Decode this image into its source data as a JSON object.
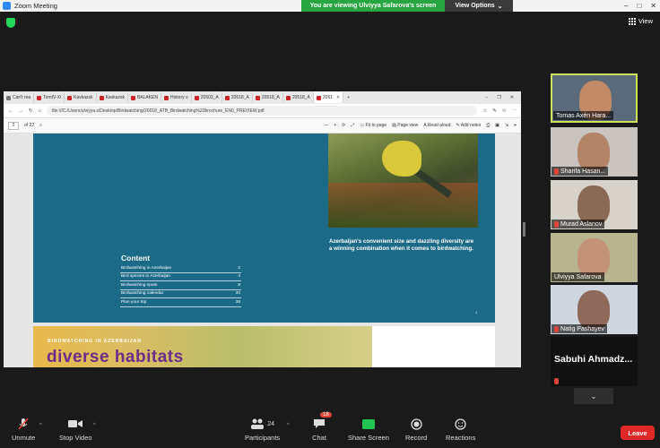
{
  "window": {
    "title": "Zoom Meeting",
    "controls": [
      "–",
      "□",
      "✕"
    ]
  },
  "banner": {
    "viewing": "You are viewing Ulviyya Safarova's screen",
    "view_options": "View Options",
    "chevron": "⌄"
  },
  "top_right": {
    "view_label": "View"
  },
  "browser": {
    "tabs": [
      {
        "label": "Can't rea"
      },
      {
        "label": "TomIV-Xi"
      },
      {
        "label": "Kavkazsk"
      },
      {
        "label": "Kavkazsk"
      },
      {
        "label": "BALAKEN"
      },
      {
        "label": "History o"
      },
      {
        "label": "20503_A"
      },
      {
        "label": "20518_A"
      },
      {
        "label": "20518_A"
      },
      {
        "label": "20518_A"
      },
      {
        "label": "2051"
      }
    ],
    "new_tab": "+",
    "url": "file:///C:/Users/ulviyya.s/Desktop/Birdwatching/20018_ATB_Birdwatching%20brochure_EN0_PREVIEW.pdf",
    "page_current": "2",
    "page_total": "of 22",
    "toolbar": {
      "zoom_out": "—",
      "zoom_in": "+",
      "fit_to_page": "Fit to page",
      "page_view": "Page view",
      "read_aloud": "Read aloud",
      "add_notes": "Add notes"
    }
  },
  "pdf": {
    "caption": "Azerbaijan's convenient size and dazzling diversity are a winning combination when it comes to birdwatching.",
    "content_title": "Content",
    "toc": [
      {
        "label": "Birdwatching in Azerbaijan",
        "page": "2"
      },
      {
        "label": "Bird species in Azerbaijan",
        "page": "4"
      },
      {
        "label": "Birdwatching spots",
        "page": "8"
      },
      {
        "label": "Birdwatching calendar",
        "page": "30"
      },
      {
        "label": "Plan your trip",
        "page": "38"
      }
    ],
    "page_number": "1",
    "page2_kicker": "BIRDWATCHING IN AZERBAIJAN",
    "page2_heading": "diverse habitats"
  },
  "participants": [
    {
      "name": "Tomas Axén Hara...",
      "muted": false,
      "active": true
    },
    {
      "name": "Sharifa Hasan...",
      "muted": true,
      "active": false
    },
    {
      "name": "Murad Aslanov",
      "muted": true,
      "active": false
    },
    {
      "name": "Ulviyya Safarova",
      "muted": false,
      "active": false
    },
    {
      "name": "Natig Pashayev",
      "muted": true,
      "active": false
    },
    {
      "name": "Sabuhi Ahmadz...",
      "muted": true,
      "active": false
    }
  ],
  "toolbar": {
    "unmute": "Unmute",
    "stop_video": "Stop Video",
    "participants": "Participants",
    "participants_count": "24",
    "chat": "Chat",
    "chat_badge": "18",
    "share_screen": "Share Screen",
    "record": "Record",
    "reactions": "Reactions",
    "leave": "Leave"
  },
  "colors": {
    "pdf_teal": "#1b6a87",
    "banner_green": "#26a540",
    "leave_red": "#e02828",
    "active_speaker": "#cfe35a",
    "heading_purple": "#6b2c8a"
  }
}
